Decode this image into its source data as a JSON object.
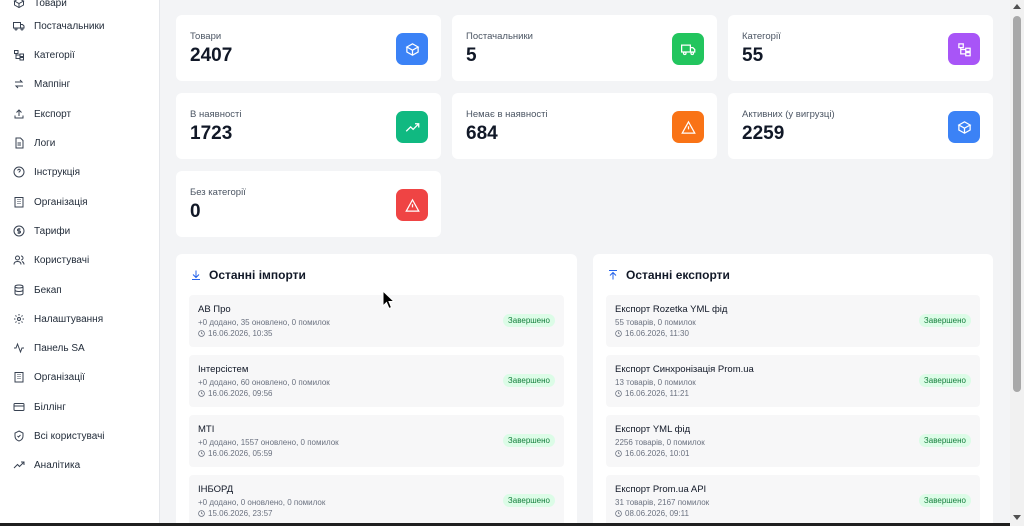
{
  "sidebar": {
    "items": [
      {
        "label": "Товари",
        "icon": "box-icon"
      },
      {
        "label": "Постачальники",
        "icon": "truck-icon"
      },
      {
        "label": "Категорії",
        "icon": "folder-tree-icon"
      },
      {
        "label": "Маппінг",
        "icon": "arrows-swap-icon"
      },
      {
        "label": "Експорт",
        "icon": "upload-icon"
      },
      {
        "label": "Логи",
        "icon": "file-text-icon"
      },
      {
        "label": "Інструкція",
        "icon": "help-circle-icon"
      },
      {
        "label": "Організація",
        "icon": "building-icon"
      },
      {
        "label": "Тарифи",
        "icon": "dollar-circle-icon"
      },
      {
        "label": "Користувачі",
        "icon": "users-icon"
      },
      {
        "label": "Бекап",
        "icon": "database-icon"
      },
      {
        "label": "Налаштування",
        "icon": "gear-icon"
      },
      {
        "label": "Панель SA",
        "icon": "activity-icon"
      },
      {
        "label": "Організації",
        "icon": "building-icon"
      },
      {
        "label": "Біллінг",
        "icon": "credit-card-icon"
      },
      {
        "label": "Всі користувачі",
        "icon": "shield-icon"
      },
      {
        "label": "Аналітика",
        "icon": "trending-up-icon"
      }
    ]
  },
  "stats": [
    {
      "label": "Товари",
      "value": "2407",
      "color": "#3b82f6",
      "icon": "box-icon"
    },
    {
      "label": "Постачальники",
      "value": "5",
      "color": "#22c55e",
      "icon": "truck-icon"
    },
    {
      "label": "Категорії",
      "value": "55",
      "color": "#a855f7",
      "icon": "folder-tree-icon"
    },
    {
      "label": "В наявності",
      "value": "1723",
      "color": "#10b981",
      "icon": "trending-up-icon"
    },
    {
      "label": "Немає в наявності",
      "value": "684",
      "color": "#f97316",
      "icon": "warning-icon"
    },
    {
      "label": "Активних (у вигрузці)",
      "value": "2259",
      "color": "#3b82f6",
      "icon": "box-icon"
    },
    {
      "label": "Без категорії",
      "value": "0",
      "color": "#ef4444",
      "icon": "warning-icon"
    }
  ],
  "imports": {
    "title": "Останні імпорти",
    "items": [
      {
        "title": "AB Про",
        "sub": "+0 додано, 35 оновлено, 0 помилок",
        "date": "16.06.2026, 10:35",
        "status": "Завершено"
      },
      {
        "title": "Інтерсістем",
        "sub": "+0 додано, 60 оновлено, 0 помилок",
        "date": "16.06.2026, 09:56",
        "status": "Завершено"
      },
      {
        "title": "MTI",
        "sub": "+0 додано, 1557 оновлено, 0 помилок",
        "date": "16.06.2026, 05:59",
        "status": "Завершено"
      },
      {
        "title": "ІНБОРД",
        "sub": "+0 додано, 0 оновлено, 0 помилок",
        "date": "15.06.2026, 23:57",
        "status": "Завершено"
      }
    ]
  },
  "exports": {
    "title": "Останні експорти",
    "items": [
      {
        "title": "Експорт Rozetka YML фід",
        "sub": "55 товарів, 0 помилок",
        "date": "16.06.2026, 11:30",
        "status": "Завершено"
      },
      {
        "title": "Експорт Синхронізація Prom.ua",
        "sub": "13 товарів, 0 помилок",
        "date": "16.06.2026, 11:21",
        "status": "Завершено"
      },
      {
        "title": "Експорт YML фід",
        "sub": "2256 товарів, 0 помилок",
        "date": "16.06.2026, 10:01",
        "status": "Завершено"
      },
      {
        "title": "Експорт Prom.ua API",
        "sub": "31 товарів, 2167 помилок",
        "date": "08.06.2026, 09:11",
        "status": "Завершено"
      }
    ]
  }
}
